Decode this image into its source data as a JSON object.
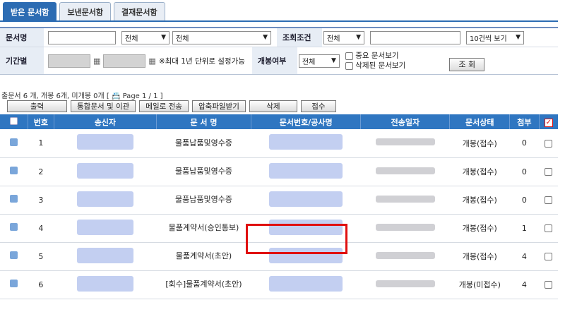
{
  "tabs": [
    {
      "label": "받은 문서함",
      "active": true
    },
    {
      "label": "보낸문서함",
      "active": false
    },
    {
      "label": "결재문서함",
      "active": false
    }
  ],
  "search": {
    "doc_name_label": "문서명",
    "doc_name_value": "",
    "filter1": "전체",
    "filter2": "전체",
    "query_cond_label": "조회조건",
    "query_cond_value": "전체",
    "query_cond_text": "",
    "page_size": "10건씩 보기",
    "period_label": "기간별",
    "period_note": "※최대 1년 단위로 설정가능",
    "opened_label": "개봉여부",
    "opened_value": "전체",
    "important_label": "중요 문서보기",
    "deleted_label": "삭제된 문서보기",
    "search_button": "조 회"
  },
  "summary": "출문서 6 개, 개봉 6개, 미개봉 0개 [ 📇 Page 1 / 1 ]",
  "toolbar": [
    "출력",
    "통합문서 및 이관",
    "메일로 전송",
    "압축파일받기",
    "삭제",
    "접수"
  ],
  "columns": [
    "번호",
    "송신자",
    "문 서 명",
    "문서번호/공사명",
    "전송일자",
    "문서상태",
    "첨부"
  ],
  "rows": [
    {
      "no": "1",
      "title": "물품납품및영수증",
      "status": "개봉(접수)",
      "attach": "0",
      "attach_link": false
    },
    {
      "no": "2",
      "title": "물품납품및영수증",
      "status": "개봉(접수)",
      "attach": "0",
      "attach_link": false
    },
    {
      "no": "3",
      "title": "물품납품및영수증",
      "status": "개봉(접수)",
      "attach": "0",
      "attach_link": false
    },
    {
      "no": "4",
      "title": "물품계약서(승인통보)",
      "status": "개봉(접수)",
      "attach": "1",
      "attach_link": true
    },
    {
      "no": "5",
      "title": "물품계약서(초안)",
      "status": "개봉(접수)",
      "attach": "4",
      "attach_link": true
    },
    {
      "no": "6",
      "title": "[회수]물품계약서(초안)",
      "status": "개봉(미접수)",
      "attach": "4",
      "attach_link": true
    }
  ],
  "colors": {
    "accent": "#2f76c1",
    "highlight": "#e01010"
  }
}
